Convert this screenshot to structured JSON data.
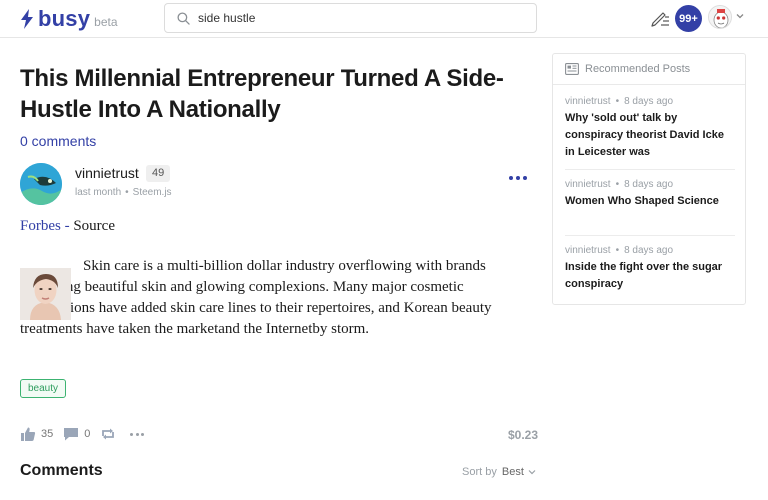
{
  "header": {
    "logo_text": "busy",
    "logo_badge": "beta",
    "search_value": "side hustle",
    "notification_count": "99+",
    "brand_color": "#3340a6"
  },
  "post": {
    "title": "This Millennial Entrepreneur Turned A Side-Hustle Into A Nationally",
    "comments_link": "0 comments",
    "author": "vinnietrust",
    "reputation": "49",
    "time": "last month",
    "app": "Steem.js",
    "source_link": "Forbes",
    "source_sep": " - ",
    "source_label": "Source",
    "body": "Skin care is a multi-billion dollar industry overflowing with brands promising beautiful skin and glowing complexions. Many major cosmetic corporations have added skin care lines to their repertoires, and Korean beauty treatments have taken the marketand the Internetby storm.",
    "tag": "beauty",
    "likes": "35",
    "comments": "0",
    "payout": "$0.23"
  },
  "comments_section": {
    "heading": "Comments",
    "sort_label": "Sort by",
    "sort_value": "Best"
  },
  "sidebar": {
    "heading": "Recommended Posts",
    "items": [
      {
        "author": "vinnietrust",
        "time": "8 days ago",
        "title": "Why 'sold out' talk by conspiracy theorist David Icke in Leicester was"
      },
      {
        "author": "vinnietrust",
        "time": "8 days ago",
        "title": "Women Who Shaped Science"
      },
      {
        "author": "vinnietrust",
        "time": "8 days ago",
        "title": "Inside the fight over the sugar conspiracy"
      }
    ]
  }
}
